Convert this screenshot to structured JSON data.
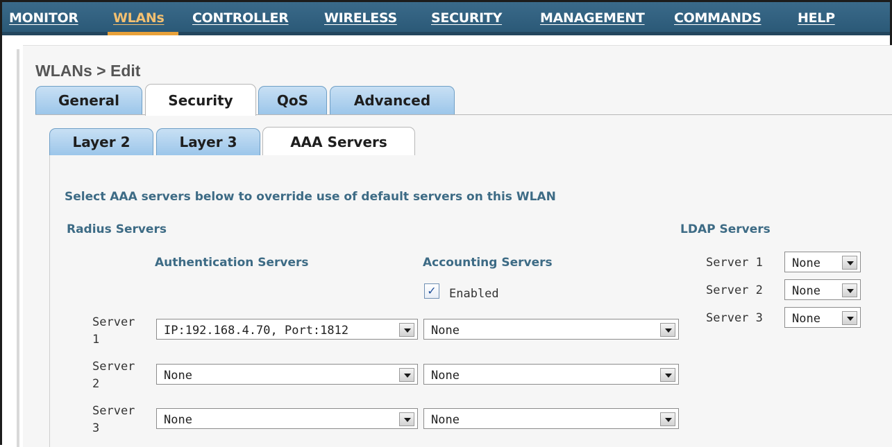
{
  "nav": {
    "items": [
      {
        "label": "MONITOR"
      },
      {
        "label": "WLANs"
      },
      {
        "label": "CONTROLLER"
      },
      {
        "label": "WIRELESS"
      },
      {
        "label": "SECURITY"
      },
      {
        "label": "MANAGEMENT"
      },
      {
        "label": "COMMANDS"
      },
      {
        "label": "HELP"
      }
    ],
    "active": "WLANs"
  },
  "page": {
    "title": "WLANs > Edit"
  },
  "tabs": {
    "primary": [
      "General",
      "Security",
      "QoS",
      "Advanced"
    ],
    "primary_active": "Security",
    "secondary": [
      "Layer 2",
      "Layer 3",
      "AAA Servers"
    ],
    "secondary_active": "AAA Servers"
  },
  "aaa": {
    "intro": "Select AAA servers below to override use of default servers on this WLAN",
    "radius_heading": "Radius Servers",
    "auth_heading": "Authentication Servers",
    "acct_heading": "Accounting Servers",
    "acct_enabled_label": "Enabled",
    "acct_enabled": true,
    "server_label": "Server",
    "rows": [
      {
        "num": "1",
        "auth": "IP:192.168.4.70, Port:1812",
        "acct": "None"
      },
      {
        "num": "2",
        "auth": "None",
        "acct": "None"
      },
      {
        "num": "3",
        "auth": "None",
        "acct": "None"
      }
    ],
    "ldap_heading": "LDAP Servers",
    "ldap": [
      {
        "label": "Server 1",
        "value": "None"
      },
      {
        "label": "Server 2",
        "value": "None"
      },
      {
        "label": "Server 3",
        "value": "None"
      }
    ]
  },
  "colors": {
    "nav_bg": "#2b5977",
    "nav_active": "#e8a13a",
    "heading": "#3d6b85",
    "tab_inactive": "#9cc6ea"
  }
}
